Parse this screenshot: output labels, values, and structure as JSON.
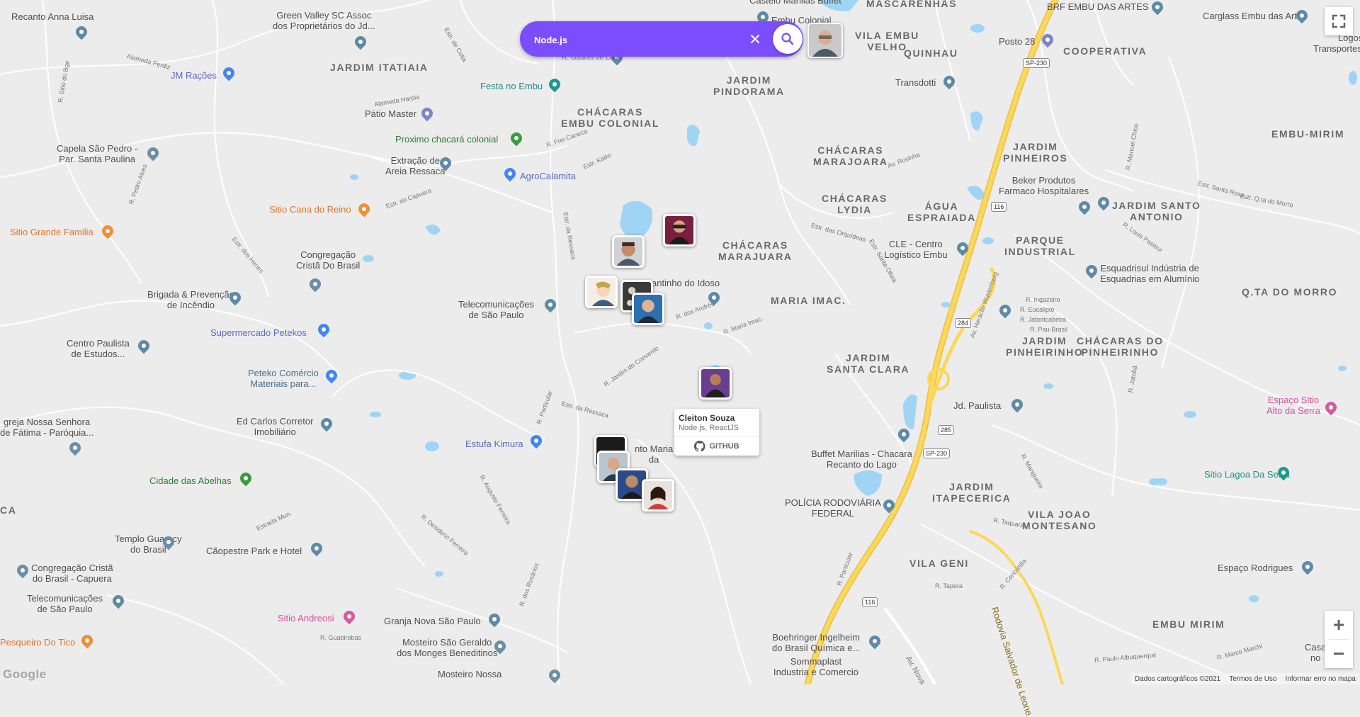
{
  "search": {
    "value": "Node.js"
  },
  "popup": {
    "name": "Cleiton Souza",
    "techs": "Node.js, ReactJS",
    "github_label": "GITHUB"
  },
  "controls": {
    "zoom_in": "+",
    "zoom_out": "−"
  },
  "footer": {
    "map_data": "Dados cartográficos ©2021",
    "terms": "Termos de Uso",
    "report": "Informar erro no mapa"
  },
  "logo": "Google",
  "area_labels": {
    "jardim_itatiaia": "JARDIM ITATIAIA",
    "chacaras_embu_colonial": "CHÁCARAS\nEMBU COLONIAL",
    "jardim_pindorama": "JARDIM\nPINDORAMA",
    "vila_embu_velho": "VILA EMBU\nVELHO",
    "mascarenhas": "MASCARENHAS",
    "quinhau": "QUINHAU",
    "cooperativa": "COOPERATIVA",
    "chacaras_marajoara": "CHÁCARAS\nMARAJOARA",
    "chacaras_lydia": "CHÁCARAS\nLYDIA",
    "agua_espraiada": "ÁGUA\nESPRAIADA",
    "jardim_pinheiros": "JARDIM\nPINHEIROS",
    "embu_mirim_top": "EMBU-MIRIM",
    "jardim_santo_antonio": "JARDIM SANTO\nANTONIO",
    "parque_industrial": "PARQUE\nINDUSTRIAL",
    "chacaras_marajuara": "CHÁCARAS\nMARAJUARA",
    "maria_imac": "MARIA IMAC.",
    "jardim_santa_clara": "JARDIM\nSANTA CLARA",
    "jardim_pinheirinho": "JARDIM\nPINHEIRINHO",
    "chacaras_do_pinheirinho": "CHÁCARAS DO\nPINHEIRINHO",
    "qta_do_morro": "Q.TA DO MORRO",
    "jardim_itapecerica": "JARDIM\nITAPECERICA",
    "vila_joao_montesano": "VILA JOAO\nMONTESANO",
    "vila_geni": "VILA GENI",
    "embu_mirim_bottom": "EMBU MIRIM",
    "ca": "CA"
  },
  "poi_labels": {
    "recanto_anna_luisa": "Recanto Anna Luisa",
    "green_valley": "Green Valley SC Assoc\ndos Proprietários do Jd...",
    "jm_racoes": "JM Rações",
    "patio_master": "Pátio Master",
    "capela_sao_pedro": "Capela São Pedro -\nPar. Santa Paulina",
    "extracao_areia": "Extração de\nAreia Ressaca",
    "proximo_chacara": "Proximo chacará colonial",
    "festa_no_embu": "Festa no Embu",
    "agrocalamita": "AgroCalamita",
    "castelo_marilias": "Castelo Marilias Buffet",
    "embu_colonial": "Embu Colonial",
    "sitio_cana_reino": "Sitio Cana do Reino",
    "sitio_grande_familia": "Sitio Grande Familia",
    "congregacao_cristo": "Congregação\nCristã Do Brasil",
    "brigada": "Brigada & Prevenção\nde Incêndio",
    "telecom_sp_1": "Telecomunicações\nde São Paulo",
    "cantinho_idoso": "antinho do Idoso",
    "supermercado_petekos": "Supermercado Petekos",
    "centro_paulista": "Centro Paulista\nde Estudos...",
    "peteko_comercio": "Peteko Comércio\nMateriais para...",
    "igreja_nossa_senhora": "greja Nossa Senhora\nde Fátima - Paróquia...",
    "ed_carlos": "Ed Carlos Corretor\nImobiliário",
    "estufa_kimura": "Estufa Kimura",
    "cidade_abelhas": "Cidade das Abelhas",
    "santa_maria": "nto Maria\nda",
    "templo_guaracy": "Templo Guaracy\ndo Brasil",
    "caopestre": "Cãopestre Park e Hotel",
    "congregacao_capuera": "Congregação Cristã\ndo Brasil - Capuera",
    "telecom_sp_2": "Telecomunicações\nde São Paulo",
    "sitio_andreosi": "Sitio Andreosi",
    "granja_nova": "Granja Nova São Paulo",
    "pesqueiro_tico": "Pesqueiro Do Tico",
    "mosteiro_sao_geraldo": "Mosteiro São Geraldo\ndos Monges Beneditinos",
    "mosteiro_nossa": "Mosteiro Nossa",
    "posto_28": "Posto 28",
    "brf_embu_artes": "BRF EMBU DAS ARTES",
    "carglass": "Carglass Embu das Artes",
    "logos_logi": "Logos Logi\nTransportes Plan",
    "transdotti": "Transdotti",
    "beker_produtos": "Beker Produtos\nFarmaco Hospitalares",
    "clc_centro": "CLE - Centro\nLogístico Embu",
    "esquadrisul": "Esquadrisul Indústria de\nEsquadrias em Alumínio",
    "jd_paulista": "Jd. Paulista",
    "espaco_sitio": "Espaço Sitio\nAlto da Serra",
    "buffet_marilias": "Buffet Marilias - Chacara\nRecanto do Lago",
    "sitio_lagoa": "Sitio Lagoa Da Serra",
    "policia_rodoviaria": "POLÍCIA RODOVIÁRIA\nFEDERAL",
    "espaco_rodrigues": "Espaço Rodrigues",
    "boehringer": "Boehringer Ingelheim\ndo Brasil Química e...",
    "sommaplast": "Sommaplast\nIndustria e Comercio",
    "casa": "Casa\nno",
    "rodovia_salvador": "Rodovia Salvador de Leone"
  },
  "road_labels": {
    "r_gabriel_lara": "R. Gabriel de Lara",
    "estr_cotia": "Estr. de Cotia",
    "alameda_harpia": "Alameda Harpia",
    "r_frei_caneca": "R. Frei Caneca",
    "estr_kaiko": "Estr. Kaiko",
    "estr_capuera": "Estr. do Capuera",
    "estr_ressaca": "Estr. da Ressaca",
    "r_pedro_alves": "R. Pedro Alves",
    "estr_dos_henos": "Estr. dos Henes",
    "av_rosinha": "Av. Rosinha",
    "estr_orquideas": "Estr. das Orquídeas",
    "estr_santa_olivia": "Estr. Santa Olivia",
    "r_dos_andres": "R. dos Andrés",
    "r_maria_imac": "R. Maria Imac.",
    "r_jardim_do_convento": "R. Jardim do Convento",
    "r_particular": "R. Particular",
    "estrada_mun": "Estrada Mun.",
    "r_desiderio_ferreira": "R. Desiderio Ferreira",
    "r_augusto_ferreira": "R. Augusto Ferreira",
    "r_dos_rosarios": "R. dos Rosários",
    "r_guabirobas": "R. Guabirobas",
    "av_heraclio": "Av. Heráclio Wustenberg",
    "r_ingazeiro": "R. Ingazeiro",
    "r_eucalipto": "R. Eucalipto",
    "r_jaboticabeira": "R. Jaboticabeira",
    "r_pau_brasil": "R. Pau-Brasil",
    "r_taquaral": "R. Taquaral",
    "r_concordia": "R. Concórdia",
    "r_tapera": "R. Tapera",
    "r_mangueira": "R. Mangueira",
    "estr_quta_morro": "Estr. Q.ta do Morro",
    "estr_santa_rosa": "Estr. Santa Rosa",
    "r_manoel_chico": "R. Manoel Chico",
    "av_nova": "Av. Nova",
    "r_particular_2": "R. Particular",
    "r_jatoba": "R. Jatobá",
    "r_louis_pasteur": "R. Louis Pasteur",
    "r_paulo_albuquerque": "R. Paulo Albuquerque",
    "r_macchi": "R. Marco Marchi",
    "r_sitio_do_bge": "R. Sitio do Bge",
    "alameda_perdiz": "Alameda Perdiz",
    "estr_da_ressaca_2": "Estr. da Ressaca"
  },
  "highway_shields": {
    "sp230_top": "SP-230",
    "br116": "116",
    "br284": "284",
    "br285": "285",
    "sp230_mid": "SP-230",
    "br116_bottom": "116"
  },
  "icons": {
    "search": "search-icon",
    "clear": "close-icon",
    "github": "github-icon",
    "fullscreen": "fullscreen-icon"
  },
  "colors": {
    "search_bar": "#7c4dff",
    "map_bg": "#ececec",
    "water": "#9fd4f5",
    "highway": "#fbd75a"
  }
}
